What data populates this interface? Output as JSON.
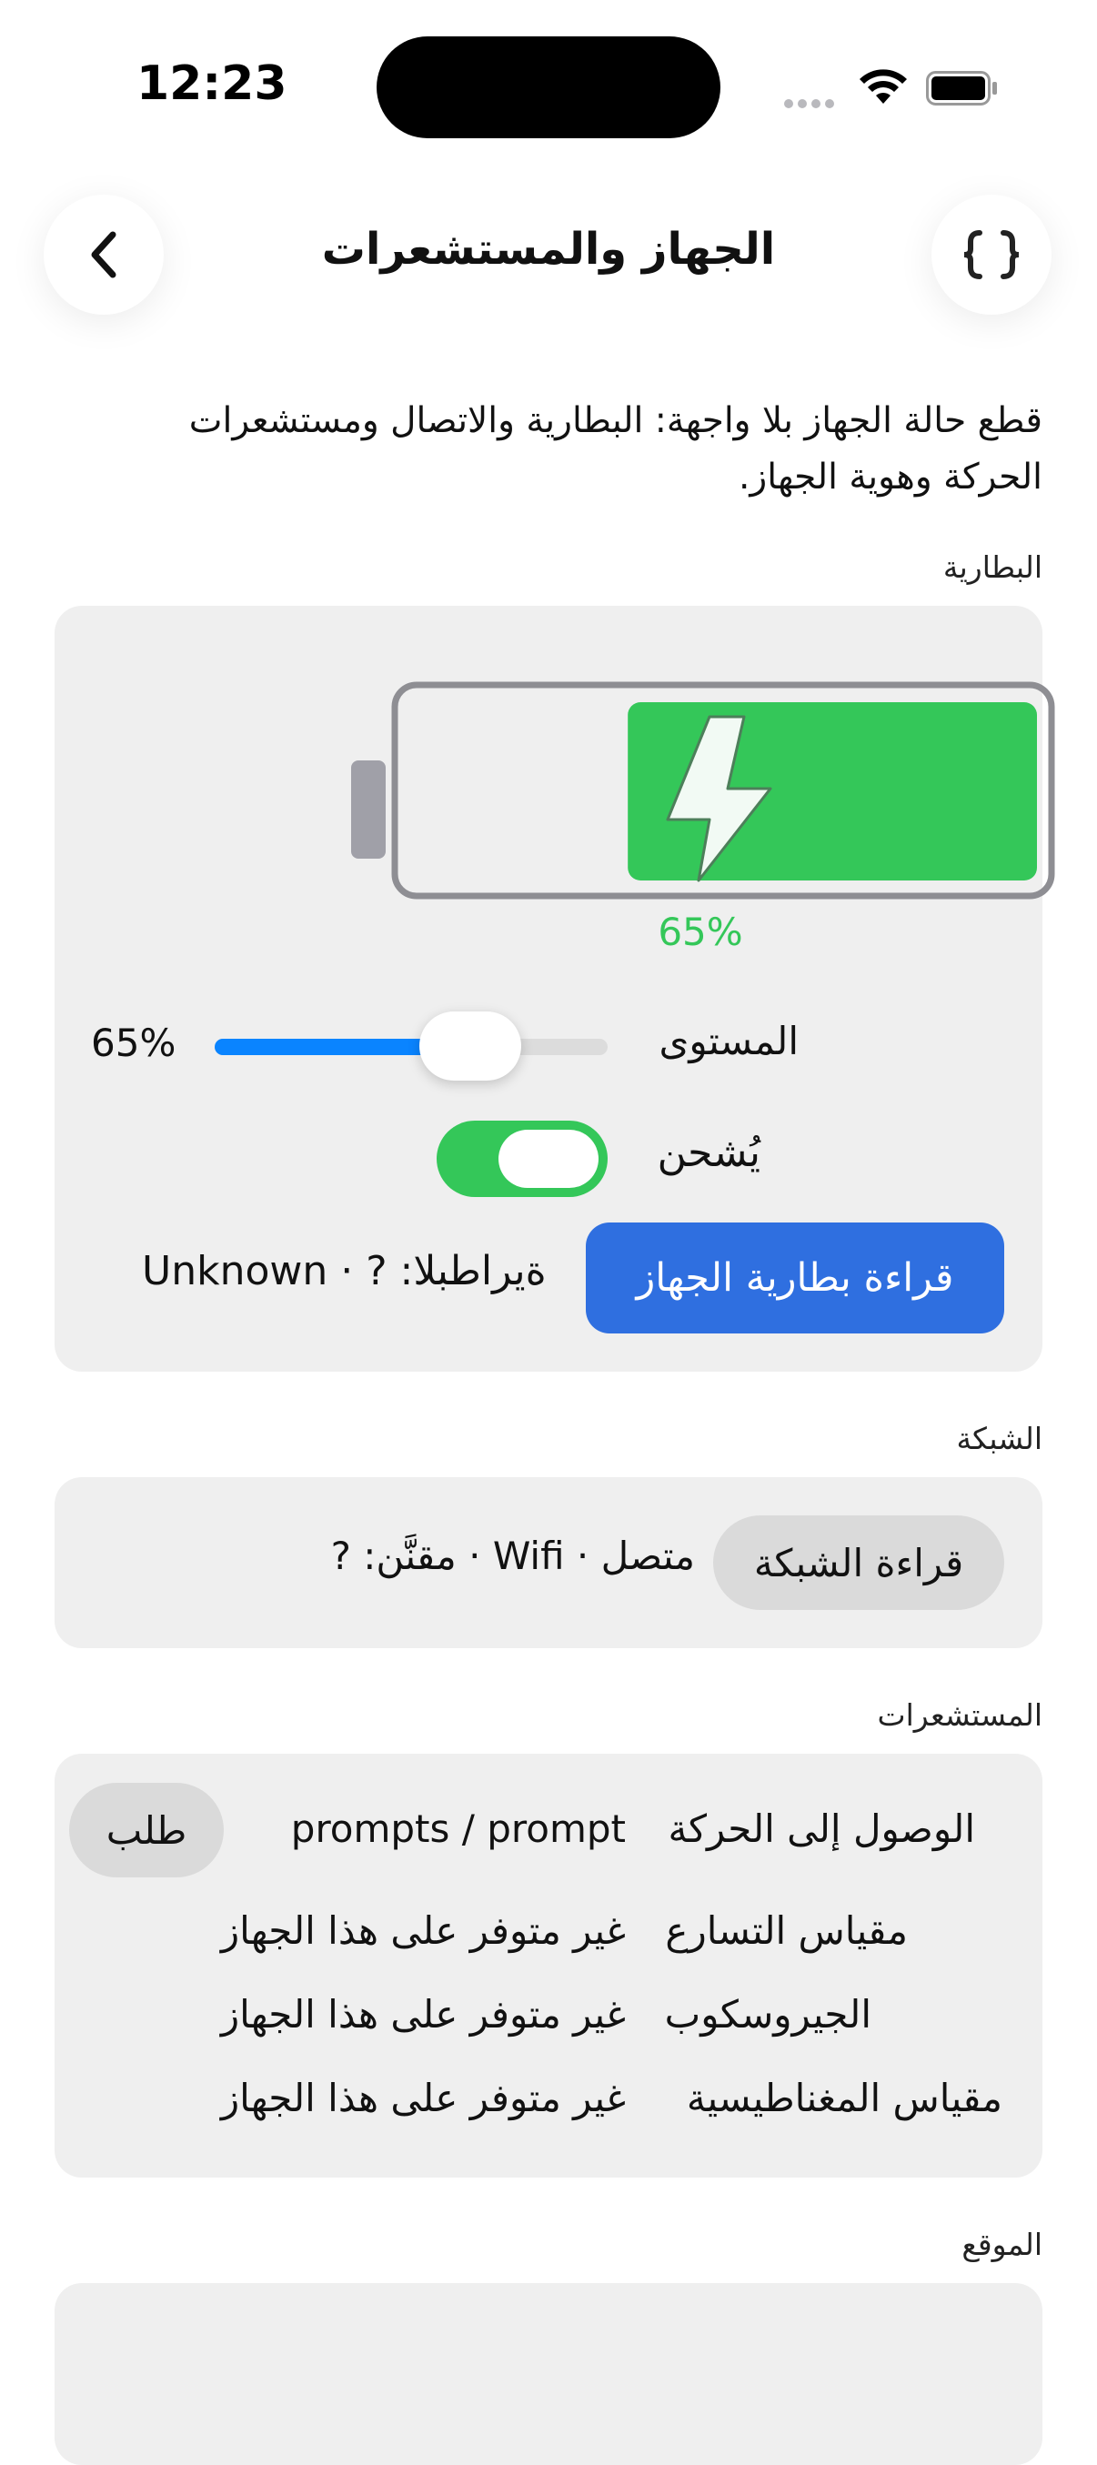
{
  "status_bar": {
    "time": "12:23"
  },
  "nav": {
    "title": "الجهاز والمستشعرات",
    "back_icon": "chevron-left-icon",
    "code_icon": "curly-braces-icon"
  },
  "intro": "قطع حالة الجهاز بلا واجهة: البطارية والاتصال ومستشعرات الحركة وهوية الجهاز.",
  "battery": {
    "section_label": "البطارية",
    "percent_text": "65%",
    "level": 0.65,
    "level_label": "المستوى",
    "slider_value": "65%",
    "charging_label": "يُشحن",
    "charging_on": true,
    "read_button": "قراءة بطارية الجهاز",
    "readout": "Unknown · ? :البطارية"
  },
  "network": {
    "section_label": "الشبكة",
    "read_button": "قراءة الشبكة",
    "readout": "متصل · Wifi · مقنَّن: ?"
  },
  "sensors": {
    "section_label": "المستشعرات",
    "rows": [
      {
        "name": "الوصول إلى الحركة",
        "value": "prompts / prompt",
        "action": "طلب"
      },
      {
        "name": "مقياس التسارع",
        "value": "غير متوفر على هذا الجهاز"
      },
      {
        "name": "الجيروسكوب",
        "value": "غير متوفر على هذا الجهاز"
      },
      {
        "name": "مقياس المغناطيسية",
        "value": "غير متوفر على هذا الجهاز"
      }
    ]
  },
  "location": {
    "section_label": "الموقع"
  },
  "colors": {
    "accent_blue": "#2f6fe0",
    "slider_blue": "#0a84ff",
    "green": "#34c759",
    "card_bg": "#efefef"
  }
}
